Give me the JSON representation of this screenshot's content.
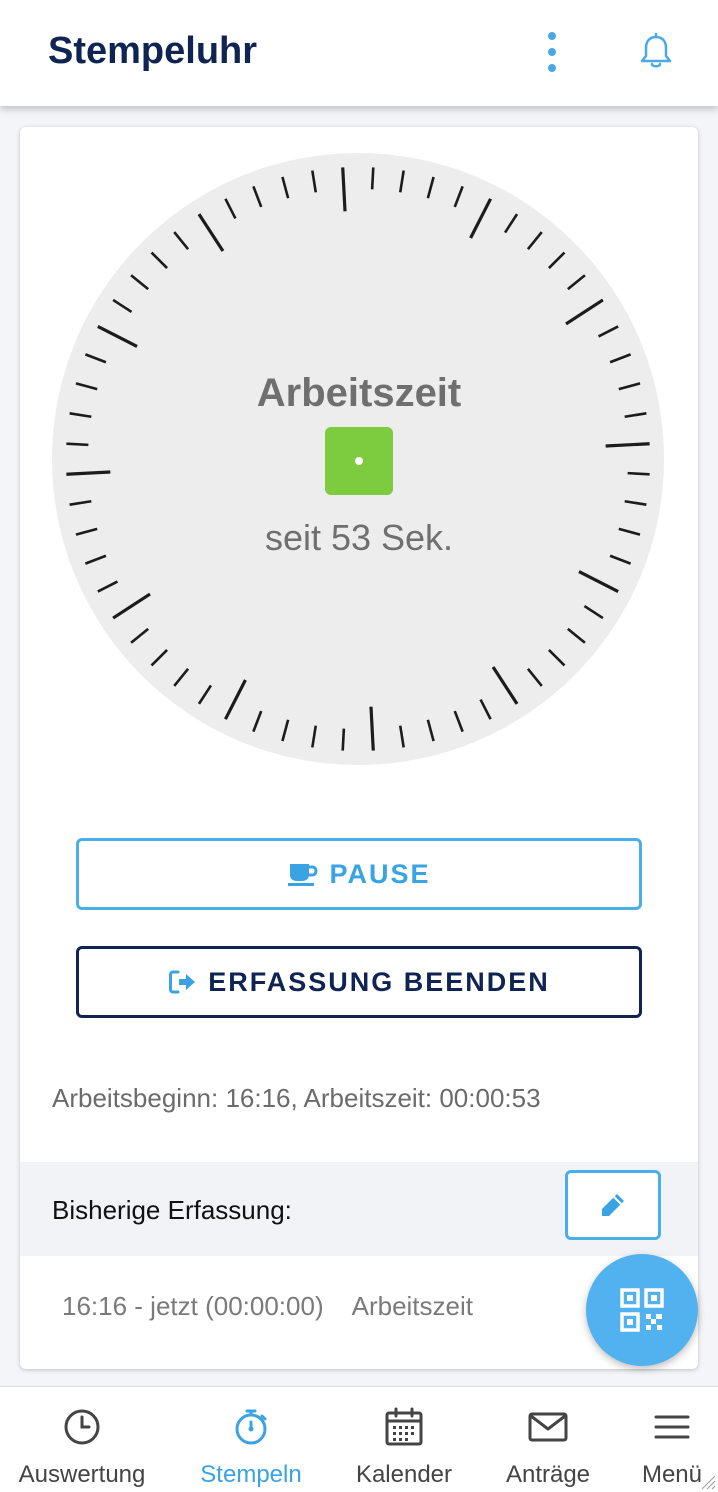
{
  "header": {
    "title": "Stempeluhr",
    "icons": {
      "menu": "more-vertical-icon",
      "notifications": "bell-icon"
    }
  },
  "clock": {
    "label": "Arbeitszeit",
    "status_color": "#7dcb3e",
    "elapsed_text": "seit 53 Sek.",
    "seconds_elapsed": 53
  },
  "actions": {
    "pause_label": "PAUSE",
    "pause_icon": "coffee-cup-icon",
    "stop_label": "ERFASSUNG BEENDEN",
    "stop_icon": "sign-out-icon"
  },
  "summary": {
    "text": "Arbeitsbeginn: 16:16, Arbeitszeit: 00:00:53"
  },
  "history": {
    "title": "Bisherige Erfassung:",
    "edit_icon": "pencil-icon",
    "entries": [
      {
        "time": "16:16 - jetzt (00:00:00)",
        "type": "Arbeitszeit"
      }
    ]
  },
  "fab": {
    "icon": "qr-code-icon"
  },
  "nav": {
    "items": [
      {
        "label": "Auswertung",
        "icon": "clock-icon"
      },
      {
        "label": "Stempeln",
        "icon": "stopwatch-icon"
      },
      {
        "label": "Kalender",
        "icon": "calendar-icon"
      },
      {
        "label": "Anträge",
        "icon": "envelope-icon"
      },
      {
        "label": "Menü",
        "icon": "hamburger-menu-icon"
      }
    ],
    "active": "Stempeln"
  },
  "colors": {
    "brand_dark": "#0f2453",
    "accent_blue": "#3aa3e3",
    "working_green": "#7dcb3e"
  }
}
